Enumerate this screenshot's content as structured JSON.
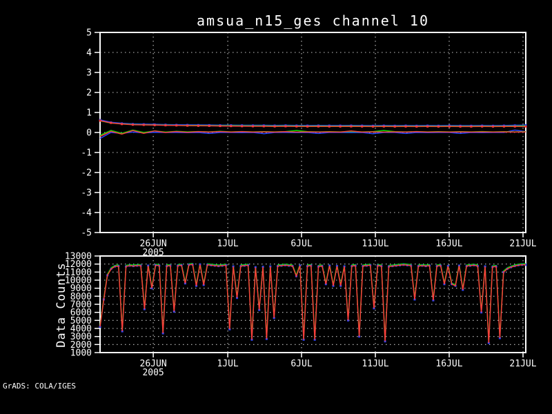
{
  "watermark": "GrADS: COLA/IGES",
  "colors": {
    "background": "#000000",
    "frame": "#ffffff",
    "grid": "#c8c8c8",
    "text": "#ffffff",
    "red": "#fa3c3c",
    "green": "#00dc00",
    "blue": "#2846ff"
  },
  "chart_data": [
    {
      "panel": "top",
      "type": "line",
      "title": "amsua_n15_ges channel 10",
      "ylim": [
        -5,
        5
      ],
      "yticks": [
        -5,
        -4,
        -3,
        -2,
        -1,
        0,
        1,
        2,
        3,
        4,
        5
      ],
      "xticks": [
        {
          "label": "26JUN",
          "sub": "2005",
          "frac": 0.125
        },
        {
          "label": "1JUL",
          "frac": 0.3
        },
        {
          "label": "6JUL",
          "frac": 0.4733
        },
        {
          "label": "11JUL",
          "frac": 0.6467
        },
        {
          "label": "16JUL",
          "frac": 0.8201
        },
        {
          "label": "21JUL",
          "frac": 0.9935
        }
      ],
      "grid": true,
      "legend": "none",
      "series": [
        {
          "name": "stdev-blue",
          "color": "blue",
          "marker": true,
          "w": 2,
          "values": [
            0.62,
            0.5,
            0.45,
            0.42,
            0.41,
            0.4,
            0.39,
            0.38,
            0.375,
            0.37,
            0.365,
            0.36,
            0.36,
            0.355,
            0.35,
            0.35,
            0.345,
            0.35,
            0.345,
            0.34,
            0.345,
            0.34,
            0.34,
            0.345,
            0.34,
            0.335,
            0.34,
            0.335,
            0.34,
            0.335,
            0.34,
            0.335,
            0.34,
            0.335,
            0.335,
            0.34,
            0.335,
            0.34,
            0.35,
            0.36
          ]
        },
        {
          "name": "stdev-green",
          "color": "green",
          "marker": false,
          "w": 1.5,
          "values": [
            0.58,
            0.47,
            0.43,
            0.4,
            0.39,
            0.38,
            0.37,
            0.36,
            0.355,
            0.35,
            0.345,
            0.34,
            0.34,
            0.335,
            0.33,
            0.33,
            0.325,
            0.33,
            0.325,
            0.32,
            0.325,
            0.32,
            0.32,
            0.325,
            0.32,
            0.315,
            0.32,
            0.315,
            0.32,
            0.315,
            0.32,
            0.315,
            0.32,
            0.315,
            0.315,
            0.32,
            0.315,
            0.32,
            0.325,
            0.33
          ]
        },
        {
          "name": "stdev-red",
          "color": "red",
          "marker": true,
          "w": 1.5,
          "values": [
            0.59,
            0.48,
            0.42,
            0.39,
            0.38,
            0.37,
            0.36,
            0.35,
            0.34,
            0.335,
            0.33,
            0.325,
            0.32,
            0.315,
            0.31,
            0.31,
            0.305,
            0.31,
            0.305,
            0.3,
            0.305,
            0.3,
            0.3,
            0.305,
            0.3,
            0.295,
            0.3,
            0.295,
            0.3,
            0.295,
            0.3,
            0.295,
            0.3,
            0.295,
            0.295,
            0.3,
            0.295,
            0.3,
            0.3,
            0.295
          ]
        },
        {
          "name": "mean-blue",
          "color": "blue",
          "marker": false,
          "w": 1.5,
          "values": [
            -0.3,
            0.0,
            -0.04,
            0.02,
            -0.02,
            0.01,
            0.0,
            0.0,
            -0.01,
            0.0,
            -0.05,
            0.0,
            0.0,
            -0.01,
            0.0,
            -0.06,
            0.0,
            0.0,
            -0.01,
            0.0,
            -0.05,
            0.0,
            0.0,
            -0.01,
            0.0,
            -0.06,
            0.0,
            0.0,
            -0.05,
            0.0,
            -0.01,
            0.0,
            0.0,
            -0.05,
            0.0,
            -0.01,
            0.0,
            0.0,
            0.12,
            0.04
          ]
        },
        {
          "name": "mean-green",
          "color": "green",
          "marker": false,
          "w": 1.5,
          "values": [
            -0.14,
            0.1,
            -0.04,
            0.12,
            0.0,
            0.08,
            0.02,
            0.06,
            0.03,
            0.05,
            0.03,
            0.06,
            0.03,
            0.05,
            0.03,
            0.04,
            0.03,
            0.05,
            0.1,
            0.04,
            0.03,
            0.04,
            0.03,
            0.05,
            0.03,
            0.04,
            0.1,
            0.04,
            0.03,
            0.05,
            0.03,
            0.04,
            0.03,
            0.04,
            0.03,
            0.05,
            0.03,
            0.04,
            0.03,
            0.04
          ]
        },
        {
          "name": "mean-red",
          "color": "red",
          "marker": false,
          "w": 1.5,
          "values": [
            -0.2,
            0.06,
            -0.08,
            0.1,
            -0.04,
            0.08,
            0.0,
            0.05,
            0.01,
            0.04,
            0.02,
            0.05,
            0.02,
            0.04,
            0.02,
            0.03,
            0.02,
            0.04,
            0.02,
            0.03,
            0.02,
            0.03,
            0.02,
            0.08,
            0.02,
            0.03,
            0.02,
            0.03,
            0.02,
            0.04,
            0.02,
            0.03,
            0.02,
            0.03,
            0.02,
            0.03,
            0.02,
            0.03,
            0.02,
            0.03
          ]
        }
      ]
    },
    {
      "panel": "bottom",
      "type": "line",
      "ylabel": "Data Counts",
      "ylim": [
        1000,
        13000
      ],
      "yticks": [
        1000,
        2000,
        3000,
        4000,
        5000,
        6000,
        7000,
        8000,
        9000,
        10000,
        11000,
        12000,
        13000
      ],
      "xticks": [
        {
          "label": "26JUN",
          "sub": "2005",
          "frac": 0.125
        },
        {
          "label": "1JUL",
          "frac": 0.3
        },
        {
          "label": "6JUL",
          "frac": 0.4733
        },
        {
          "label": "11JUL",
          "frac": 0.6467
        },
        {
          "label": "16JUL",
          "frac": 0.8201
        },
        {
          "label": "21JUL",
          "frac": 0.9935
        }
      ],
      "grid": true,
      "legend": "none",
      "counts": [
        4200,
        7600,
        10600,
        11400,
        11700,
        11750,
        3650,
        11700,
        11800,
        11750,
        11800,
        11800,
        6400,
        11800,
        9000,
        11850,
        11800,
        3400,
        11750,
        11800,
        6100,
        11800,
        11850,
        9600,
        11900,
        11950,
        9300,
        11950,
        9400,
        11900,
        11850,
        11800,
        11750,
        11800,
        11850,
        3900,
        11700,
        7800,
        11750,
        11800,
        11850,
        2600,
        11600,
        6300,
        11650,
        2700,
        11700,
        5300,
        11750,
        11800,
        11850,
        11800,
        11750,
        10500,
        11800,
        2600,
        11750,
        11800,
        2600,
        11700,
        11750,
        9500,
        11800,
        9300,
        11750,
        9300,
        11700,
        5000,
        11750,
        11800,
        3000,
        11750,
        11800,
        11850,
        6500,
        11800,
        11750,
        2400,
        11700,
        11750,
        11800,
        11850,
        11900,
        11850,
        11800,
        7600,
        11750,
        11800,
        11750,
        11800,
        7500,
        11750,
        11800,
        9500,
        11750,
        9500,
        9300,
        11800,
        8800,
        11750,
        11800,
        11850,
        11750,
        6000,
        11700,
        2200,
        11650,
        11700,
        2800,
        11000,
        11400,
        11600,
        11750,
        11850,
        11900,
        11900
      ],
      "series": [
        {
          "name": "counts-green",
          "color": "green",
          "values_ref": "counts",
          "marker": false,
          "w": 1.5,
          "dy": -1.5
        },
        {
          "name": "counts-blue",
          "color": "blue",
          "values_ref": "counts",
          "marker_only": true
        },
        {
          "name": "counts-red",
          "color": "red",
          "values_ref": "counts",
          "marker": false,
          "w": 1.5
        }
      ]
    }
  ]
}
